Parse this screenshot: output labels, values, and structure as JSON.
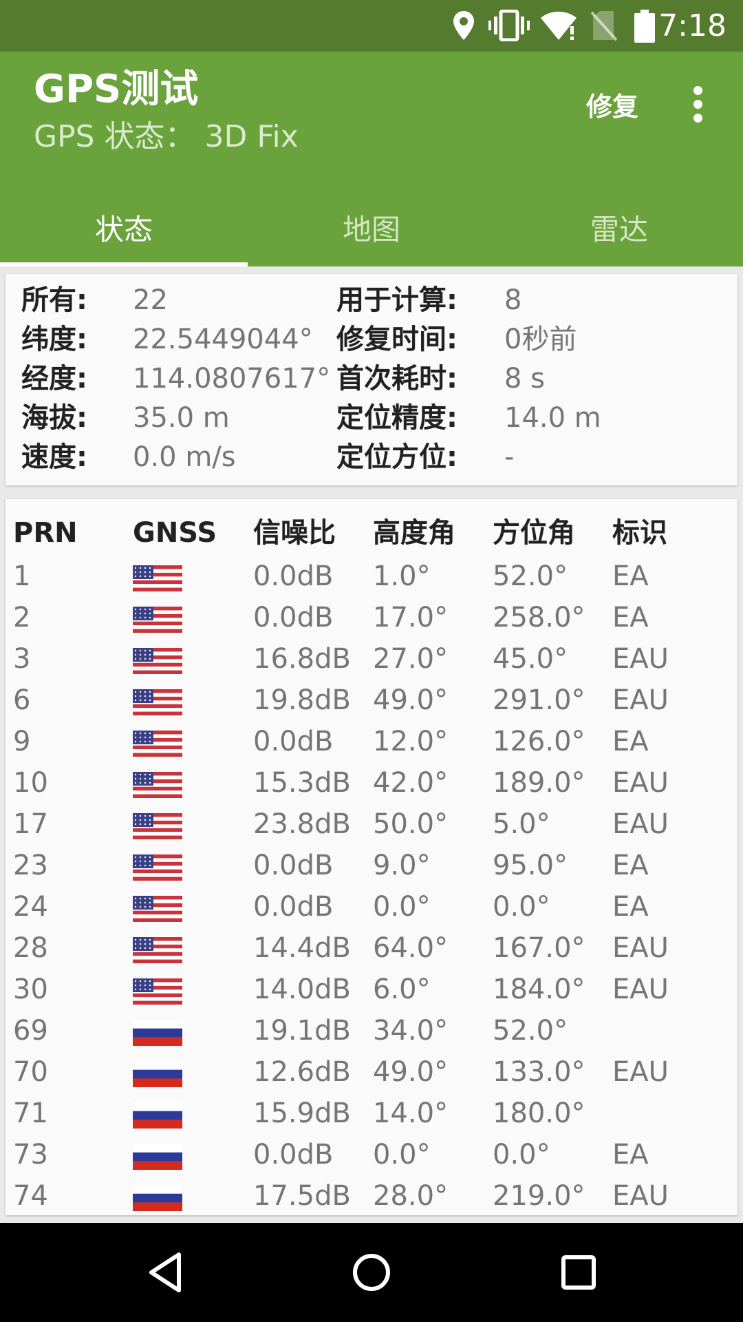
{
  "status_bar": {
    "time": "7:18",
    "icons": [
      "location-icon",
      "vibrate-icon",
      "wifi-icon",
      "no-sim-icon",
      "battery-icon"
    ]
  },
  "app": {
    "title": "GPS测试",
    "subtitle": "GPS 状态： 3D Fix",
    "fix_label": "修复",
    "more_icon": "more-vert-icon"
  },
  "tabs": [
    {
      "label": "状态",
      "active": true
    },
    {
      "label": "地图",
      "active": false
    },
    {
      "label": "雷达",
      "active": false
    }
  ],
  "summary": {
    "left": [
      {
        "label": "所有:",
        "value": "22"
      },
      {
        "label": "纬度:",
        "value": "22.5449044°"
      },
      {
        "label": "经度:",
        "value": "114.0807617°"
      },
      {
        "label": "海拔:",
        "value": "35.0 m"
      },
      {
        "label": "速度:",
        "value": "0.0 m/s"
      }
    ],
    "right": [
      {
        "label": "用于计算:",
        "value": "8"
      },
      {
        "label": "修复时间:",
        "value": "0秒前"
      },
      {
        "label": "首次耗时:",
        "value": "8 s"
      },
      {
        "label": "定位精度:",
        "value": "14.0 m"
      },
      {
        "label": "定位方位:",
        "value": "-"
      }
    ]
  },
  "satellites": {
    "headers": [
      "PRN",
      "GNSS",
      "信噪比",
      "高度角",
      "方位角",
      "标识"
    ],
    "rows": [
      {
        "prn": "1",
        "gnss": "us-flag-icon",
        "snr": "0.0dB",
        "elev": "1.0°",
        "azim": "52.0°",
        "flags": "EA"
      },
      {
        "prn": "2",
        "gnss": "us-flag-icon",
        "snr": "0.0dB",
        "elev": "17.0°",
        "azim": "258.0°",
        "flags": "EA"
      },
      {
        "prn": "3",
        "gnss": "us-flag-icon",
        "snr": "16.8dB",
        "elev": "27.0°",
        "azim": "45.0°",
        "flags": "EAU"
      },
      {
        "prn": "6",
        "gnss": "us-flag-icon",
        "snr": "19.8dB",
        "elev": "49.0°",
        "azim": "291.0°",
        "flags": "EAU"
      },
      {
        "prn": "9",
        "gnss": "us-flag-icon",
        "snr": "0.0dB",
        "elev": "12.0°",
        "azim": "126.0°",
        "flags": "EA"
      },
      {
        "prn": "10",
        "gnss": "us-flag-icon",
        "snr": "15.3dB",
        "elev": "42.0°",
        "azim": "189.0°",
        "flags": "EAU"
      },
      {
        "prn": "17",
        "gnss": "us-flag-icon",
        "snr": "23.8dB",
        "elev": "50.0°",
        "azim": "5.0°",
        "flags": "EAU"
      },
      {
        "prn": "23",
        "gnss": "us-flag-icon",
        "snr": "0.0dB",
        "elev": "9.0°",
        "azim": "95.0°",
        "flags": "EA"
      },
      {
        "prn": "24",
        "gnss": "us-flag-icon",
        "snr": "0.0dB",
        "elev": "0.0°",
        "azim": "0.0°",
        "flags": "EA"
      },
      {
        "prn": "28",
        "gnss": "us-flag-icon",
        "snr": "14.4dB",
        "elev": "64.0°",
        "azim": "167.0°",
        "flags": "EAU"
      },
      {
        "prn": "30",
        "gnss": "us-flag-icon",
        "snr": "14.0dB",
        "elev": "6.0°",
        "azim": "184.0°",
        "flags": "EAU"
      },
      {
        "prn": "69",
        "gnss": "ru-flag-icon",
        "snr": "19.1dB",
        "elev": "34.0°",
        "azim": "52.0°",
        "flags": ""
      },
      {
        "prn": "70",
        "gnss": "ru-flag-icon",
        "snr": "12.6dB",
        "elev": "49.0°",
        "azim": "133.0°",
        "flags": "EAU"
      },
      {
        "prn": "71",
        "gnss": "ru-flag-icon",
        "snr": "15.9dB",
        "elev": "14.0°",
        "azim": "180.0°",
        "flags": ""
      },
      {
        "prn": "73",
        "gnss": "ru-flag-icon",
        "snr": "0.0dB",
        "elev": "0.0°",
        "azim": "0.0°",
        "flags": "EA"
      },
      {
        "prn": "74",
        "gnss": "ru-flag-icon",
        "snr": "17.5dB",
        "elev": "28.0°",
        "azim": "219.0°",
        "flags": "EAU"
      }
    ]
  },
  "nav_bar": {
    "icons": [
      "back-icon",
      "home-icon",
      "recents-icon"
    ]
  },
  "colors": {
    "status_bar": "#557c2e",
    "app_bar": "#6aa23c",
    "label_text": "#222222",
    "value_text": "#757575"
  }
}
